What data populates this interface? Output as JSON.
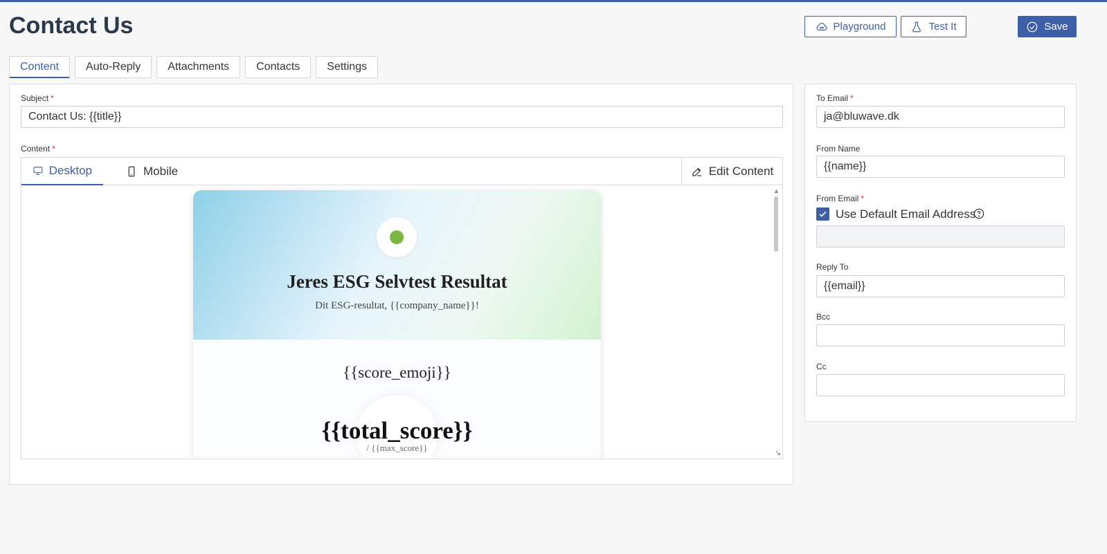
{
  "page": {
    "title": "Contact Us"
  },
  "header": {
    "playground_label": "Playground",
    "test_label": "Test It",
    "save_label": "Save"
  },
  "tabs": [
    {
      "label": "Content",
      "active": true
    },
    {
      "label": "Auto-Reply"
    },
    {
      "label": "Attachments"
    },
    {
      "label": "Contacts"
    },
    {
      "label": "Settings"
    }
  ],
  "form": {
    "subject_label": "Subject",
    "subject_value": "Contact Us: {{title}}",
    "content_label": "Content",
    "required_mark": "*"
  },
  "editor": {
    "desktop_label": "Desktop",
    "mobile_label": "Mobile",
    "edit_label": "Edit Content"
  },
  "preview": {
    "title": "Jeres ESG Selvtest Resultat",
    "subtitle": "Dit ESG-resultat, {{company_name}}!",
    "score_emoji": "{{score_emoji}}",
    "total_score": "{{total_score}}",
    "max_score": "/ {{max_score}}"
  },
  "sidebar": {
    "to_email_label": "To Email",
    "to_email_value": "ja@bluwave.dk",
    "from_name_label": "From Name",
    "from_name_value": "{{name}}",
    "from_email_label": "From Email",
    "use_default_label": "Use Default Email Address",
    "use_default_checked": true,
    "from_email_value": "",
    "reply_to_label": "Reply To",
    "reply_to_value": "{{email}}",
    "bcc_label": "Bcc",
    "bcc_value": "",
    "cc_label": "Cc",
    "cc_value": ""
  },
  "colors": {
    "accent": "#3f5ea8",
    "required": "#e8383d"
  }
}
